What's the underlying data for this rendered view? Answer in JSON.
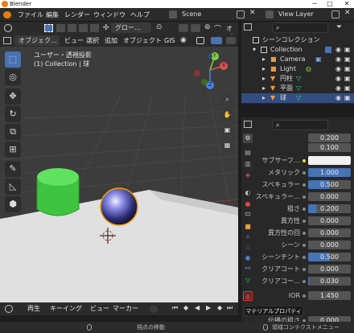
{
  "window": {
    "title": "Blender",
    "minimize": "─",
    "maximize": "□",
    "close": "✕"
  },
  "menu": {
    "items": [
      "ファイル",
      "編集",
      "レンダー",
      "ウィンドウ",
      "ヘルプ"
    ],
    "scene": "Scene",
    "view_layer": "View Layer"
  },
  "toolbar": {
    "transform": "グロー…",
    "options": "オプ"
  },
  "viewport_header": {
    "mode": "オブジェク…",
    "items": [
      "ビュー",
      "選択",
      "追加",
      "オブジェクト",
      "GIS"
    ]
  },
  "viewport": {
    "view_name": "ユーザー・透視投影",
    "collection": "(1) Collection | 球",
    "axes": {
      "x": "X",
      "y": "Y",
      "z": "Z"
    }
  },
  "outliner": {
    "root": "シーンコレクション",
    "items": [
      "Collection",
      "Camera",
      "Light",
      "円柱",
      "平面",
      "球"
    ]
  },
  "properties": {
    "top_values": [
      "0.200",
      "0.100"
    ],
    "rows": [
      {
        "label": "サブサーフ…",
        "value": ""
      },
      {
        "label": "メタリック",
        "value": "1.000"
      },
      {
        "label": "スペキュラー",
        "value": "0.500"
      },
      {
        "label": "スペキュラー…",
        "value": "0.000"
      },
      {
        "label": "粗さ",
        "value": "0.200"
      },
      {
        "label": "異方性",
        "value": "0.000"
      },
      {
        "label": "異方性の回",
        "value": "0.000"
      },
      {
        "label": "シーン",
        "value": "0.000"
      },
      {
        "label": "シーンチント",
        "value": "0.500"
      },
      {
        "label": "クリアコート",
        "value": "0.000"
      },
      {
        "label": "クリアコー…",
        "value": "0.030"
      },
      {
        "label": "IOR",
        "value": "1.450"
      },
      {
        "label": "伝播の粗さ",
        "value": "0.000"
      }
    ],
    "tooltip": "マテリアルプロパティ"
  },
  "timeline": {
    "items": [
      "再生",
      "キーイング",
      "ビュー",
      "マーカー"
    ]
  },
  "status": {
    "left": "視点の移動",
    "right": "領域コンテクストメニュー"
  }
}
